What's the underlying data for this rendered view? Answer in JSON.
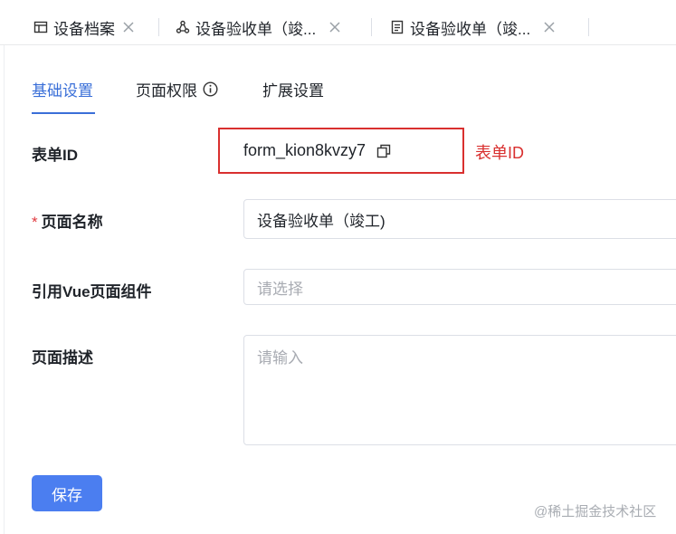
{
  "tabs": [
    {
      "label": "设备档案",
      "icon": "table-icon"
    },
    {
      "label": "设备验收单（竣...",
      "icon": "flow-icon"
    },
    {
      "label": "设备验收单（竣...",
      "icon": "document-icon"
    }
  ],
  "subtabs": {
    "basic": "基础设置",
    "permission": "页面权限",
    "extend": "扩展设置"
  },
  "form": {
    "form_id_label": "表单ID",
    "form_id_value": "form_kion8kvzy7",
    "annotation": "表单ID",
    "page_name_label": "页面名称",
    "page_name_value": "设备验收单（竣工)",
    "vue_label": "引用Vue页面组件",
    "vue_placeholder": "请选择",
    "desc_label": "页面描述",
    "desc_placeholder": "请输入",
    "required_mark": "*"
  },
  "actions": {
    "save": "保存"
  },
  "watermark": "@稀土掘金技术社区",
  "colors": {
    "accent": "#3a6fd8",
    "button": "#4b7ef0",
    "annotation": "#d9302f"
  }
}
